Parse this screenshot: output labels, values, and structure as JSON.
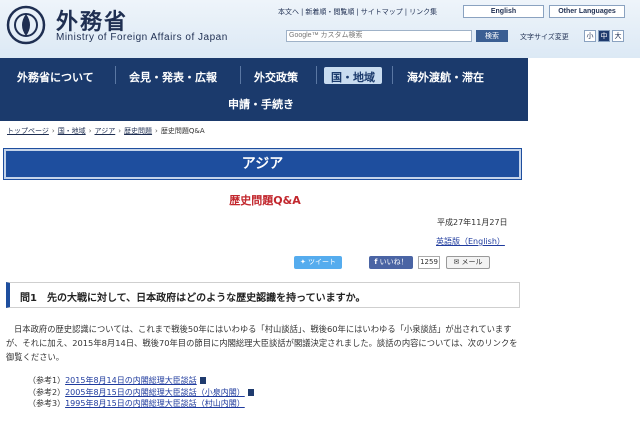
{
  "header": {
    "logo_ja": "外務省",
    "logo_en": "Ministry of Foreign Affairs of Japan",
    "top_links": [
      "本文へ",
      "新着順・閲覧順",
      "サイトマップ",
      "リンク集"
    ],
    "lang_english": "English",
    "lang_other": "Other Languages",
    "search_placeholder": "Google™ カスタム検索",
    "search_button": "検索",
    "fontsize_label": "文字サイズ変更",
    "fontsize_options": [
      "小",
      "中",
      "大"
    ],
    "fontsize_selected": "中"
  },
  "nav": {
    "items": [
      "外務省について",
      "会見・発表・広報",
      "外交政策",
      "国・地域",
      "海外渡航・滞在",
      "申請・手続き"
    ],
    "active": "国・地域"
  },
  "breadcrumb": {
    "items": [
      "トップページ",
      "国・地域",
      "アジア",
      "歴史問題"
    ],
    "current": "歴史問題Q&A"
  },
  "region_title": "アジア",
  "page_title": "歴史問題Q&A",
  "date": "平成27年11月27日",
  "language_links": "英語版（English）",
  "social": {
    "tweet": "ツイート",
    "like": "いいね！",
    "like_count": "1259",
    "mail": "メール"
  },
  "question": "問1　先の大戦に対して、日本政府はどのような歴史認識を持っていますか。",
  "answer": "日本政府の歴史認識については、これまで戦後50年にはいわゆる「村山談話」、戦後60年にはいわゆる「小泉談話」が出されていますが、それに加え、2015年8月14日、戦後70年目の節目に内閣総理大臣談話が閣議決定されました。談話の内容については、次のリンクを御覧ください。",
  "references": [
    {
      "prefix": "（参考1）",
      "link": "2015年8月14日の内閣総理大臣談話"
    },
    {
      "prefix": "（参考2）",
      "link": "2005年8月15日の内閣総理大臣談話（小泉内閣）"
    },
    {
      "prefix": "（参考3）",
      "link": "1995年8月15日の内閣総理大臣談話（村山内閣）"
    }
  ],
  "colors": {
    "nav_bg": "#1b3a6c",
    "banner_bg": "#1e4e9e",
    "title_red": "#c2272d",
    "link_blue": "#1f3b9e"
  }
}
